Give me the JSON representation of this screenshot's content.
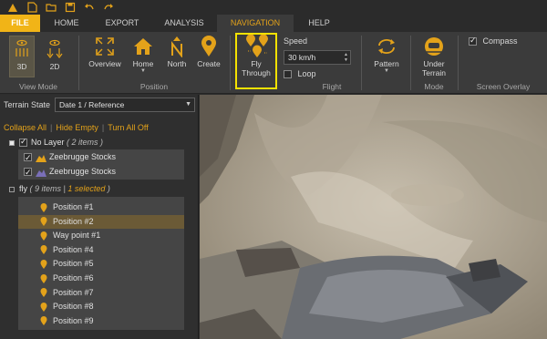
{
  "tabs": [
    {
      "label": "FILE"
    },
    {
      "label": "HOME"
    },
    {
      "label": "EXPORT"
    },
    {
      "label": "ANALYSIS"
    },
    {
      "label": "NAVIGATION"
    },
    {
      "label": "HELP"
    }
  ],
  "ribbon": {
    "view_mode": {
      "btn_3d": "3D",
      "btn_2d": "2D",
      "label": "View Mode"
    },
    "position": {
      "overview": "Overview",
      "home": "Home",
      "north": "North",
      "create": "Create",
      "label": "Position"
    },
    "flight": {
      "fly_through_line1": "Fly",
      "fly_through_line2": "Through",
      "speed_label": "Speed",
      "speed_value": "30 km/h",
      "loop_label": "Loop",
      "label": "Flight"
    },
    "pattern": {
      "label_btn": "Pattern"
    },
    "mode": {
      "under_terrain_line1": "Under",
      "under_terrain_line2": "Terrain",
      "label": "Mode"
    },
    "overlay": {
      "compass_label": "Compass",
      "label": "Screen Overlay"
    }
  },
  "panel": {
    "terrain_state_label": "Terrain State",
    "terrain_state_value": "Date 1 / Reference",
    "links": {
      "collapse": "Collapse All",
      "hide_empty": "Hide Empty",
      "turn_off": "Turn All Off"
    },
    "no_layer": {
      "name": "No Layer",
      "count": "( 2 items )",
      "items": [
        "Zeebrugge Stocks",
        "Zeebrugge Stocks"
      ]
    },
    "fly": {
      "name": "fly",
      "count_open": "( 9 items | ",
      "selected": "1 selected",
      "count_close": " )",
      "items": [
        "Position #1",
        "Position #2",
        "Way point #1",
        "Position #4",
        "Position #5",
        "Position #6",
        "Position #7",
        "Position #8",
        "Position #9"
      ],
      "selected_index": 1
    }
  },
  "colors": {
    "accent": "#e3a21a",
    "file_tab": "#f1b417",
    "highlight": "#f5e200"
  }
}
